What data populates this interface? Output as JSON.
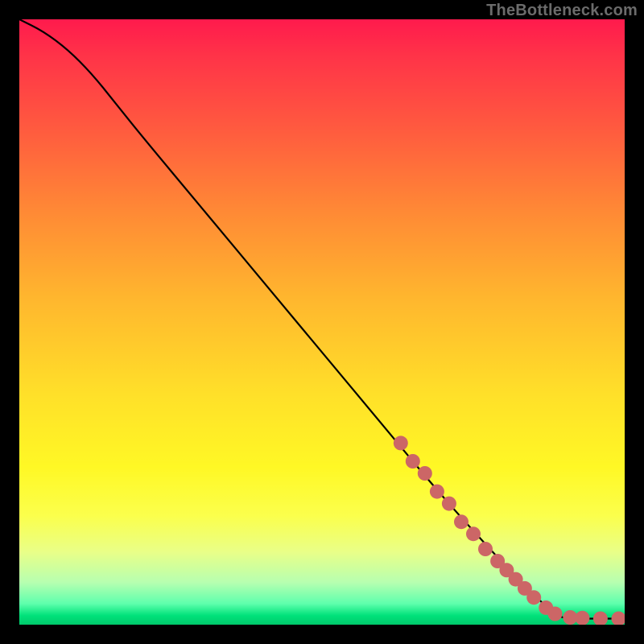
{
  "attribution": "TheBottleneck.com",
  "chart_data": {
    "type": "line",
    "title": "",
    "xlabel": "",
    "ylabel": "",
    "xlim": [
      0,
      100
    ],
    "ylim": [
      0,
      100
    ],
    "series": [
      {
        "name": "curve",
        "x": [
          0,
          4,
          8,
          12,
          16,
          20,
          30,
          40,
          50,
          60,
          70,
          80,
          84,
          88,
          90,
          93,
          96,
          100
        ],
        "y": [
          100,
          98,
          95,
          91,
          86,
          81,
          69,
          57,
          45,
          33,
          21,
          10,
          6,
          2,
          1,
          1,
          1,
          1
        ]
      }
    ],
    "markers": {
      "name": "highlight-segment",
      "color": "#cc6666",
      "points": [
        {
          "x": 63,
          "y": 30
        },
        {
          "x": 65,
          "y": 27
        },
        {
          "x": 67,
          "y": 25
        },
        {
          "x": 69,
          "y": 22
        },
        {
          "x": 71,
          "y": 20
        },
        {
          "x": 73,
          "y": 17
        },
        {
          "x": 75,
          "y": 15
        },
        {
          "x": 77,
          "y": 12.5
        },
        {
          "x": 79,
          "y": 10.5
        },
        {
          "x": 80.5,
          "y": 9
        },
        {
          "x": 82,
          "y": 7.5
        },
        {
          "x": 83.5,
          "y": 6
        },
        {
          "x": 85,
          "y": 4.5
        },
        {
          "x": 87,
          "y": 2.8
        },
        {
          "x": 88.5,
          "y": 1.8
        },
        {
          "x": 91,
          "y": 1.2
        },
        {
          "x": 93,
          "y": 1.1
        },
        {
          "x": 96,
          "y": 1.0
        },
        {
          "x": 99,
          "y": 1.0
        }
      ]
    },
    "background_gradient": {
      "top": "#ff1a4d",
      "mid": "#ffe029",
      "bottom": "#00c96b"
    }
  }
}
